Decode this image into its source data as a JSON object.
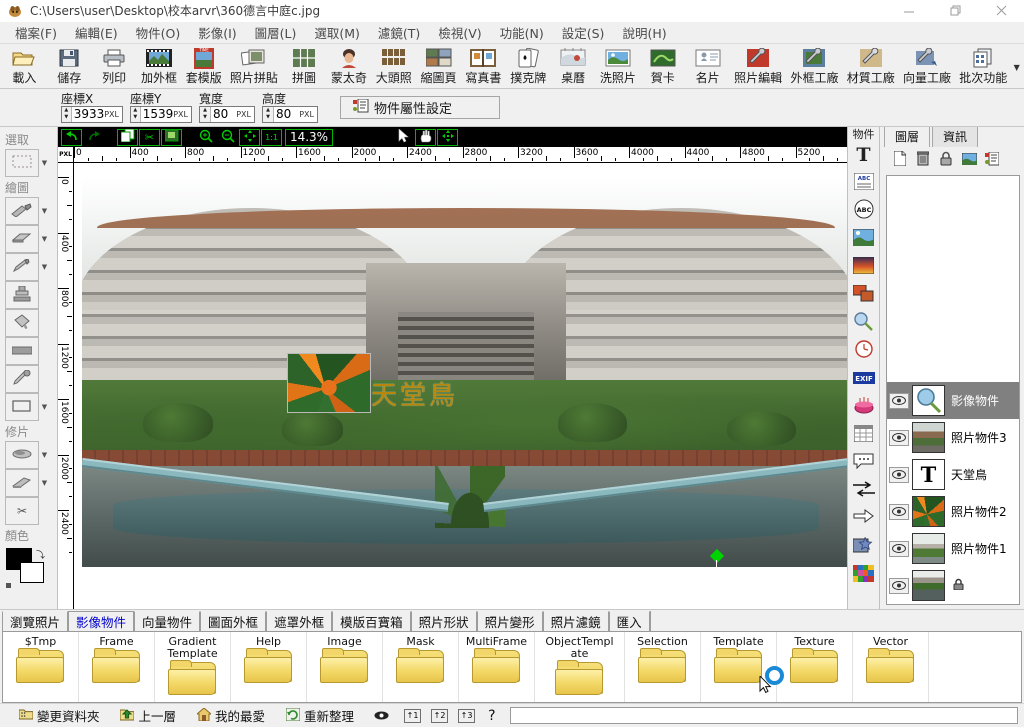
{
  "titlebar": {
    "icon": "app-icon",
    "path": "C:\\Users\\user\\Desktop\\校本arvr\\360德言中庭c.jpg",
    "minimize": "—",
    "maximize": "❐",
    "close": "✕"
  },
  "menubar": {
    "items": [
      {
        "label": "檔案(F)"
      },
      {
        "label": "編輯(E)"
      },
      {
        "label": "物件(O)"
      },
      {
        "label": "影像(I)"
      },
      {
        "label": "圖層(L)"
      },
      {
        "label": "選取(M)"
      },
      {
        "label": "濾鏡(T)"
      },
      {
        "label": "檢視(V)"
      },
      {
        "label": "功能(N)"
      },
      {
        "label": "設定(S)"
      },
      {
        "label": "說明(H)"
      }
    ]
  },
  "toolbar": {
    "buttons": [
      {
        "label": "載入",
        "icon": "open-folder-icon"
      },
      {
        "label": "儲存",
        "icon": "floppy-save-icon"
      },
      {
        "label": "列印",
        "icon": "printer-icon"
      },
      {
        "label": "加外框",
        "icon": "film-frame-icon"
      },
      {
        "label": "套模版",
        "icon": "template-icon"
      },
      {
        "label": "照片拼貼",
        "icon": "photo-collage-icon"
      },
      {
        "label": "拼圖",
        "icon": "puzzle-grid-icon"
      },
      {
        "label": "蒙太奇",
        "icon": "montage-portrait-icon"
      },
      {
        "label": "大頭照",
        "icon": "id-photo-grid-icon"
      },
      {
        "label": "縮圖頁",
        "icon": "contact-sheet-icon"
      },
      {
        "label": "寫真書",
        "icon": "photo-book-icon"
      },
      {
        "label": "撲克牌",
        "icon": "playing-cards-icon"
      },
      {
        "label": "桌曆",
        "icon": "desk-calendar-icon"
      },
      {
        "label": "洗照片",
        "icon": "print-photo-icon"
      },
      {
        "label": "賀卡",
        "icon": "greeting-card-icon"
      },
      {
        "label": "名片",
        "icon": "business-card-icon"
      },
      {
        "label": "照片編輯",
        "icon": "photo-edit-wrench-icon"
      },
      {
        "label": "外框工廠",
        "icon": "frame-factory-icon"
      },
      {
        "label": "材質工廠",
        "icon": "texture-factory-icon"
      },
      {
        "label": "向量工廠",
        "icon": "vector-factory-icon"
      },
      {
        "label": "批次功能",
        "icon": "batch-process-icon"
      }
    ],
    "overflow_icon": "chevron-down-icon"
  },
  "attrbar": {
    "fields": [
      {
        "caption": "座標X",
        "value": "3933",
        "unit": "PXL"
      },
      {
        "caption": "座標Y",
        "value": "1539",
        "unit": "PXL"
      },
      {
        "caption": "寬度",
        "value": "80",
        "unit": "PXL"
      },
      {
        "caption": "高度",
        "value": "80",
        "unit": "PXL"
      }
    ],
    "object_properties_button": "物件屬性設定",
    "object_properties_icon": "object-properties-icon"
  },
  "left_toolbox": {
    "sections": [
      {
        "title": "選取",
        "tools": [
          {
            "name": "marquee-select-tool",
            "icon": "dashed-rectangle-icon",
            "has_dropdown": true
          }
        ]
      },
      {
        "title": "繪圖",
        "tools": [
          {
            "name": "paintbrush-tool",
            "icon": "paintbrush-icon",
            "has_dropdown": true
          },
          {
            "name": "eraser-tool",
            "icon": "eraser-icon",
            "has_dropdown": true
          },
          {
            "name": "pencil-tool",
            "icon": "pencil-icon",
            "has_dropdown": true
          },
          {
            "name": "clone-stamp-tool",
            "icon": "clone-stamp-icon",
            "has_dropdown": false
          },
          {
            "name": "paint-bucket-tool",
            "icon": "paint-bucket-icon",
            "has_dropdown": false
          },
          {
            "name": "gradient-tool",
            "icon": "gradient-bar-icon",
            "has_dropdown": false
          },
          {
            "name": "eyedropper-tool",
            "icon": "eyedropper-icon",
            "has_dropdown": false
          },
          {
            "name": "shape-tool",
            "icon": "rectangle-shape-icon",
            "has_dropdown": true
          }
        ]
      },
      {
        "title": "修片",
        "tools": [
          {
            "name": "blur-retouch-tool",
            "icon": "blur-drop-icon",
            "has_dropdown": true
          },
          {
            "name": "burn-dodge-tool",
            "icon": "burn-tool-icon",
            "has_dropdown": true
          },
          {
            "name": "red-eye-removal-tool",
            "icon": "scissors-retouch-icon",
            "has_dropdown": false
          }
        ]
      },
      {
        "title": "顏色",
        "foreground_color": "#000000",
        "background_color": "#ffffff",
        "swap_icon": "swap-colors-icon"
      }
    ]
  },
  "image_toolbar": {
    "buttons": [
      {
        "name": "undo-button",
        "icon": "undo-arrow-icon",
        "boxed": true
      },
      {
        "name": "redo-button",
        "icon": "redo-arrow-icon",
        "boxed": false
      },
      {
        "name": "copy-button",
        "icon": "copy-pages-icon",
        "boxed": true
      },
      {
        "name": "cut-button",
        "icon": "scissors-icon",
        "boxed": true
      },
      {
        "name": "paste-button",
        "icon": "paste-clipboard-icon",
        "boxed": true
      },
      {
        "name": "zoom-in-button",
        "icon": "magnifier-plus-icon",
        "boxed": false
      },
      {
        "name": "zoom-out-button",
        "icon": "magnifier-minus-icon",
        "boxed": false
      },
      {
        "name": "fit-to-window-button",
        "icon": "fit-screen-icon",
        "boxed": true
      },
      {
        "name": "actual-size-button",
        "icon": "one-to-one-icon",
        "boxed": true
      }
    ],
    "zoom_level": "14.3%",
    "mode_buttons": [
      {
        "name": "pointer-tool",
        "icon": "arrow-cursor-icon",
        "boxed": false
      },
      {
        "name": "pan-hand-tool",
        "icon": "hand-icon",
        "boxed": true
      },
      {
        "name": "move-object-tool",
        "icon": "move-cross-icon",
        "boxed": true
      }
    ]
  },
  "rulers": {
    "unit_label": "PXL",
    "horizontal_ticks": [
      "0",
      "400",
      "800",
      "1200",
      "1600",
      "2000",
      "2400",
      "2800",
      "3200",
      "3600",
      "4000",
      "4400",
      "4800",
      "5200"
    ],
    "vertical_ticks": [
      "0",
      "400",
      "800",
      "1200",
      "1600",
      "2000",
      "2400"
    ]
  },
  "canvas": {
    "text_object": "天堂鳥",
    "text_color": "#b8860b",
    "selected_object_handles": "9-dot-handle-grid",
    "anchor_icon": "green-diamond-anchor-icon"
  },
  "object_strip": {
    "title": "物件",
    "tools": [
      {
        "name": "text-tool",
        "icon": "letter-T-icon"
      },
      {
        "name": "text-box-tool",
        "icon": "abc-textbox-icon"
      },
      {
        "name": "path-text-tool",
        "icon": "abc-circle-icon"
      },
      {
        "name": "image-object-tool",
        "icon": "picture-icon"
      },
      {
        "name": "gradient-object-tool",
        "icon": "sunset-gradient-icon"
      },
      {
        "name": "multi-image-tool",
        "icon": "two-photos-icon"
      },
      {
        "name": "magnifier-object-tool",
        "icon": "magnifier-icon"
      },
      {
        "name": "clock-object-tool",
        "icon": "clock-icon"
      },
      {
        "name": "exif-object-tool",
        "icon": "exif-badge-icon"
      },
      {
        "name": "birthday-object-tool",
        "icon": "birthday-cake-icon"
      },
      {
        "name": "calendar-object-tool",
        "icon": "calendar-icon"
      },
      {
        "name": "speech-bubble-tool",
        "icon": "speech-bubble-icon"
      },
      {
        "name": "double-arrow-tool",
        "icon": "double-arrow-icon"
      },
      {
        "name": "arrow-shape-tool",
        "icon": "block-arrow-icon"
      },
      {
        "name": "sticker-tool",
        "icon": "star-sticker-icon"
      },
      {
        "name": "color-palette-tool",
        "icon": "color-mosaic-icon"
      }
    ]
  },
  "right_panel": {
    "tabs": [
      {
        "label": "圖層",
        "active": true
      },
      {
        "label": "資訊",
        "active": false
      }
    ],
    "tools": [
      {
        "name": "new-layer-button",
        "icon": "new-page-icon"
      },
      {
        "name": "delete-layer-button",
        "icon": "trash-icon"
      },
      {
        "name": "lock-layer-button",
        "icon": "padlock-icon"
      },
      {
        "name": "merge-layer-button",
        "icon": "picture-icon"
      },
      {
        "name": "layer-properties-button",
        "icon": "properties-list-icon"
      }
    ],
    "layers": [
      {
        "name": "影像物件",
        "visible": true,
        "selected": true,
        "thumb": "magnifier",
        "locked": false
      },
      {
        "name": "照片物件3",
        "visible": true,
        "selected": false,
        "thumb": "photo3",
        "locked": false
      },
      {
        "name": "天堂鳥",
        "visible": true,
        "selected": false,
        "thumb": "text",
        "locked": false
      },
      {
        "name": "照片物件2",
        "visible": true,
        "selected": false,
        "thumb": "photo2",
        "locked": false
      },
      {
        "name": "照片物件1",
        "visible": true,
        "selected": false,
        "thumb": "photo1",
        "locked": false
      },
      {
        "name": "",
        "visible": true,
        "selected": false,
        "thumb": "background",
        "locked": true
      }
    ]
  },
  "bottom_tabs": [
    {
      "label": "瀏覽照片",
      "active": false
    },
    {
      "label": "影像物件",
      "active": true
    },
    {
      "label": "向量物件",
      "active": false
    },
    {
      "label": "圖面外框",
      "active": false
    },
    {
      "label": "遮罩外框",
      "active": false
    },
    {
      "label": "模版百寶箱",
      "active": false
    },
    {
      "label": "照片形狀",
      "active": false
    },
    {
      "label": "照片變形",
      "active": false
    },
    {
      "label": "照片濾鏡",
      "active": false
    },
    {
      "label": "匯入",
      "active": false
    }
  ],
  "gallery": {
    "folders": [
      {
        "name": "$Tmp"
      },
      {
        "name": "Frame"
      },
      {
        "name": "Gradient Template"
      },
      {
        "name": "Help"
      },
      {
        "name": "Image"
      },
      {
        "name": "Mask"
      },
      {
        "name": "MultiFrame"
      },
      {
        "name": "ObjectTemplate"
      },
      {
        "name": "Selection"
      },
      {
        "name": "Template"
      },
      {
        "name": "Texture"
      },
      {
        "name": "Vector"
      }
    ],
    "cursor": "busy-arrow-cursor"
  },
  "statusbar": {
    "items": [
      {
        "label": "變更資料夾",
        "icon": "change-folder-icon"
      },
      {
        "label": "上一層",
        "icon": "up-folder-icon"
      },
      {
        "label": "我的最愛",
        "icon": "home-favorites-icon"
      },
      {
        "label": "重新整理",
        "icon": "refresh-icon"
      }
    ],
    "toggle_icon": "eye-icon",
    "view_buttons": [
      "1",
      "2",
      "3"
    ],
    "help": "?"
  }
}
